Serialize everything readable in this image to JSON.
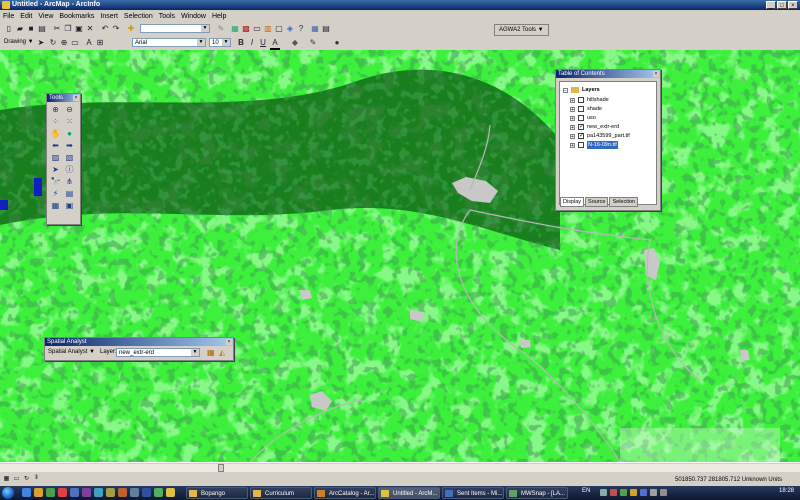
{
  "window": {
    "title": "Untitled - ArcMap - ArcInfo"
  },
  "menu": [
    "File",
    "Edit",
    "View",
    "Bookmarks",
    "Insert",
    "Selection",
    "Tools",
    "Window",
    "Help"
  ],
  "toolbar": {
    "scale_value": "",
    "agwa_label": "AGWA2 Tools ▼",
    "drawing_label": "Drawing ▼",
    "font_name": "Arial",
    "font_size": "10",
    "bold": "B",
    "italic": "I",
    "underline": "U",
    "font_color_letter": "A"
  },
  "tools_window": {
    "title": "Tools"
  },
  "toc": {
    "title": "Table of Contents",
    "root": "Layers",
    "layers": [
      {
        "name": "hillshade",
        "checked": false
      },
      {
        "name": "shade",
        "checked": false
      },
      {
        "name": "uso",
        "checked": false
      },
      {
        "name": "new_extr-erd",
        "checked": true
      },
      {
        "name": "pa143599_part.tif",
        "checked": true
      },
      {
        "name": "N-16-09n.tif",
        "checked": false,
        "selected": true
      }
    ],
    "tabs": [
      "Display",
      "Source",
      "Selection"
    ]
  },
  "spatial_analyst": {
    "title": "Spatial Analyst",
    "menu_label": "Spatial Analyst ▼",
    "layer_label": "Layer:",
    "layer_value": "new_extr-erd"
  },
  "status": {
    "coords": "501850.737  281805.712 Unknown Units"
  },
  "taskbar": {
    "items": [
      "Bopango",
      "Curriculum",
      "ArcCatalog - Ar...",
      "Untitled - ArcM...",
      "Sent Items - Mi...",
      "MWSnap - [LA..."
    ],
    "lang": "EN",
    "clock": "18:28"
  },
  "colors": {
    "forest": "#0d5a14",
    "grass": "#3cf03c",
    "urban": "#c8c8c8",
    "water": "#1020c0"
  }
}
